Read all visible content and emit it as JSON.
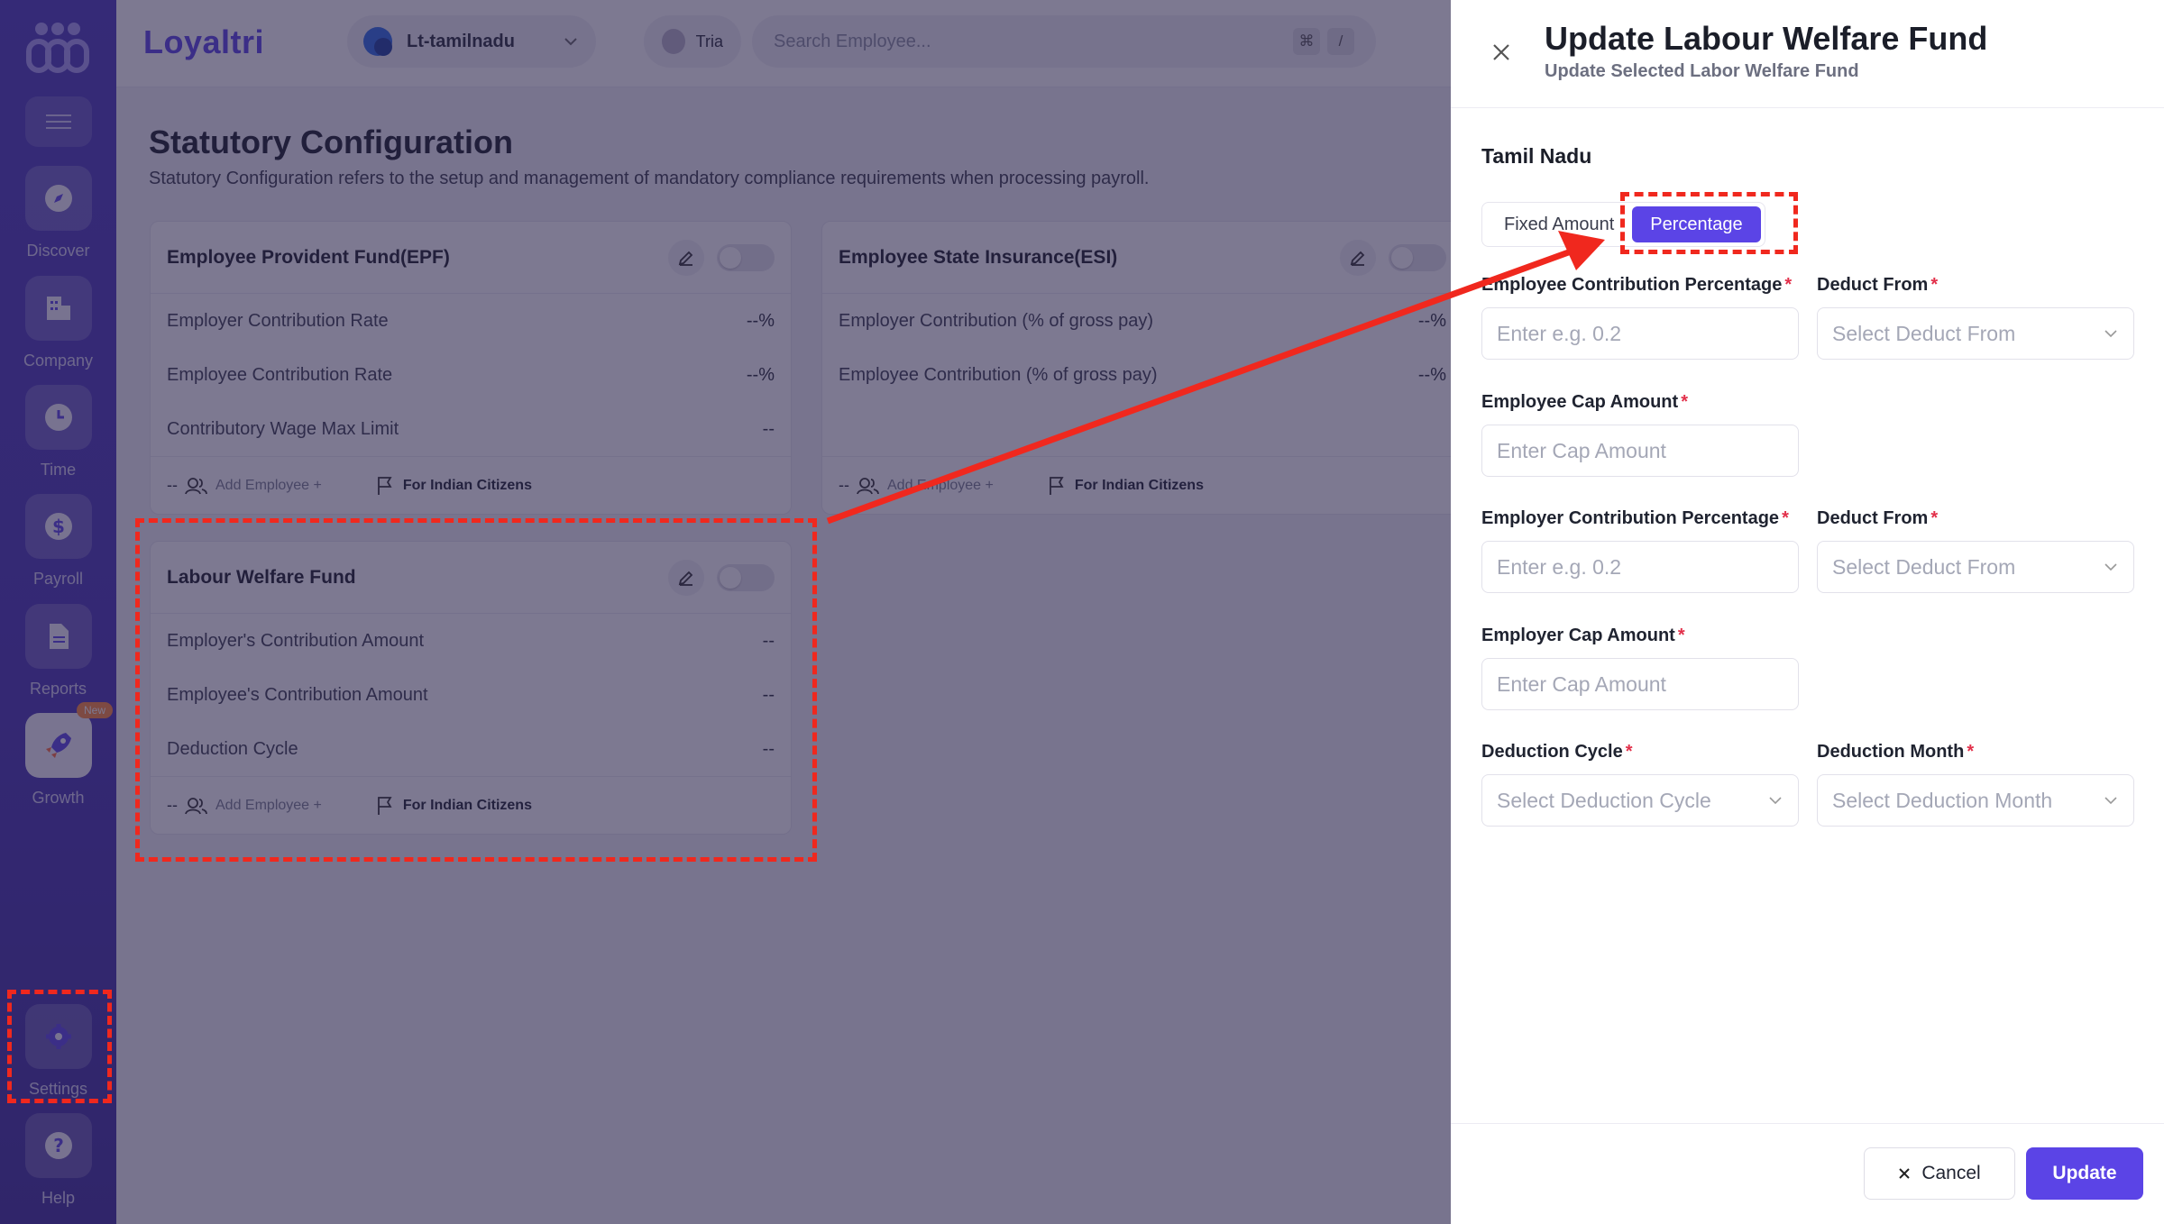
{
  "sidebar": {
    "items": [
      {
        "label": "Discover",
        "icon": "compass-icon"
      },
      {
        "label": "Company",
        "icon": "building-icon"
      },
      {
        "label": "Time",
        "icon": "clock-icon"
      },
      {
        "label": "Payroll",
        "icon": "dollar-icon"
      },
      {
        "label": "Reports",
        "icon": "document-icon"
      },
      {
        "label": "Growth",
        "icon": "rocket-icon",
        "badge": "New"
      }
    ],
    "settings_label": "Settings",
    "help_label": "Help"
  },
  "topbar": {
    "brand": "Loyaltri",
    "org": "Lt-tamilnadu",
    "user": "Tria",
    "search_placeholder": "Search Employee...",
    "shortcut_keys": [
      "⌘",
      "/"
    ]
  },
  "page": {
    "title": "Statutory Configuration",
    "description": "Statutory Configuration refers to the setup and management of mandatory compliance requirements when processing payroll."
  },
  "cards": {
    "epf": {
      "title": "Employee Provident Fund(EPF)",
      "rows": [
        {
          "label": "Employer Contribution Rate",
          "value": "--%"
        },
        {
          "label": "Employee Contribution Rate",
          "value": "--%"
        },
        {
          "label": "Contributory Wage Max Limit",
          "value": "--"
        }
      ],
      "footer": {
        "dash": "--",
        "add": "Add Employee +",
        "citizens": "For Indian Citizens"
      }
    },
    "esi": {
      "title": "Employee State Insurance(ESI)",
      "rows": [
        {
          "label": "Employer Contribution (% of gross pay)",
          "value": "--%"
        },
        {
          "label": "Employee Contribution (% of gross pay)",
          "value": "--%"
        }
      ],
      "footer": {
        "dash": "--",
        "add": "Add Employee +",
        "citizens": "For Indian Citizens"
      }
    },
    "lwf": {
      "title": "Labour Welfare Fund",
      "rows": [
        {
          "label": "Employer's Contribution Amount",
          "value": "--"
        },
        {
          "label": "Employee's Contribution Amount",
          "value": "--"
        },
        {
          "label": "Deduction Cycle",
          "value": "--"
        }
      ],
      "footer": {
        "dash": "--",
        "add": "Add Employee +",
        "citizens": "For Indian Citizens"
      }
    }
  },
  "drawer": {
    "title": "Update Labour Welfare Fund",
    "subtitle": "Update Selected Labor Welfare Fund",
    "state": "Tamil Nadu",
    "tabs": {
      "fixed": "Fixed Amount",
      "percentage": "Percentage"
    },
    "active_tab": "Percentage",
    "fields": {
      "employee_pct": {
        "label": "Employee Contribution Percentage",
        "placeholder": "Enter e.g. 0.2"
      },
      "employee_deduct": {
        "label": "Deduct From",
        "placeholder": "Select Deduct From"
      },
      "employee_cap": {
        "label": "Employee Cap Amount",
        "placeholder": "Enter Cap Amount"
      },
      "employer_pct": {
        "label": "Employer Contribution Percentage",
        "placeholder": "Enter e.g. 0.2"
      },
      "employer_deduct": {
        "label": "Deduct From",
        "placeholder": "Select Deduct From"
      },
      "employer_cap": {
        "label": "Employer Cap Amount",
        "placeholder": "Enter Cap Amount"
      },
      "deduction_cycle": {
        "label": "Deduction Cycle",
        "placeholder": "Select Deduction Cycle"
      },
      "deduction_month": {
        "label": "Deduction Month",
        "placeholder": "Select Deduction Month"
      }
    },
    "required_mark": "*",
    "cancel_label": "Cancel",
    "update_label": "Update"
  },
  "colors": {
    "brand": "#5b44e6",
    "sidebar": "#4c3bbd",
    "annotation": "#f0281e",
    "required": "#e2304a"
  }
}
